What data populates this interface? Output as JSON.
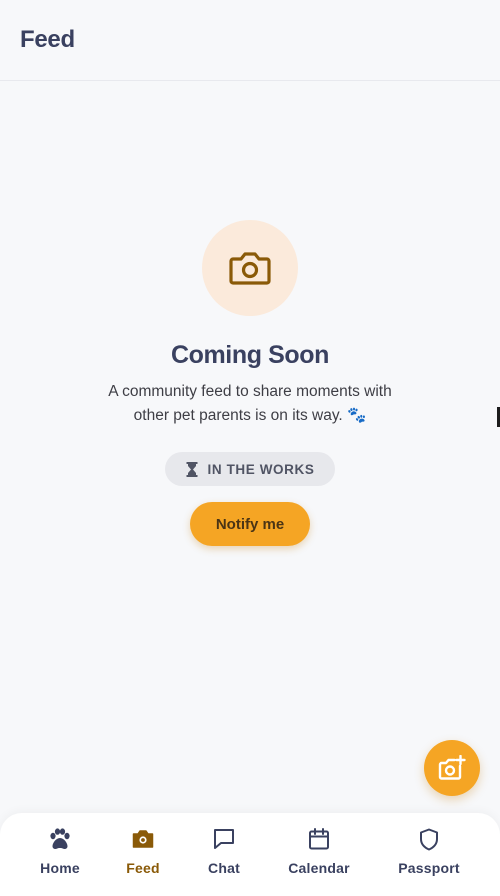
{
  "header": {
    "title": "Feed"
  },
  "main": {
    "hero_icon": "camera-icon",
    "title": "Coming Soon",
    "description_line1": "A community feed to share moments with",
    "description_line2": "other pet parents is on its way. 🐾",
    "badge": {
      "icon": "hourglass-icon",
      "label": "IN THE WORKS"
    },
    "notify_label": "Notify me"
  },
  "fab": {
    "icon": "add-photo-icon"
  },
  "tabs": [
    {
      "label": "Home",
      "icon": "paw-icon",
      "active": false
    },
    {
      "label": "Feed",
      "icon": "camera-icon",
      "active": true
    },
    {
      "label": "Chat",
      "icon": "chat-icon",
      "active": false
    },
    {
      "label": "Calendar",
      "icon": "calendar-icon",
      "active": false
    },
    {
      "label": "Passport",
      "icon": "shield-icon",
      "active": false
    }
  ],
  "colors": {
    "accent": "#f5a524",
    "hero_bg": "#fbeadb",
    "hero_icon": "#8a5a08",
    "text_primary": "#3a4160",
    "active_tab": "#8a5a08",
    "background": "#f7f8fa"
  }
}
